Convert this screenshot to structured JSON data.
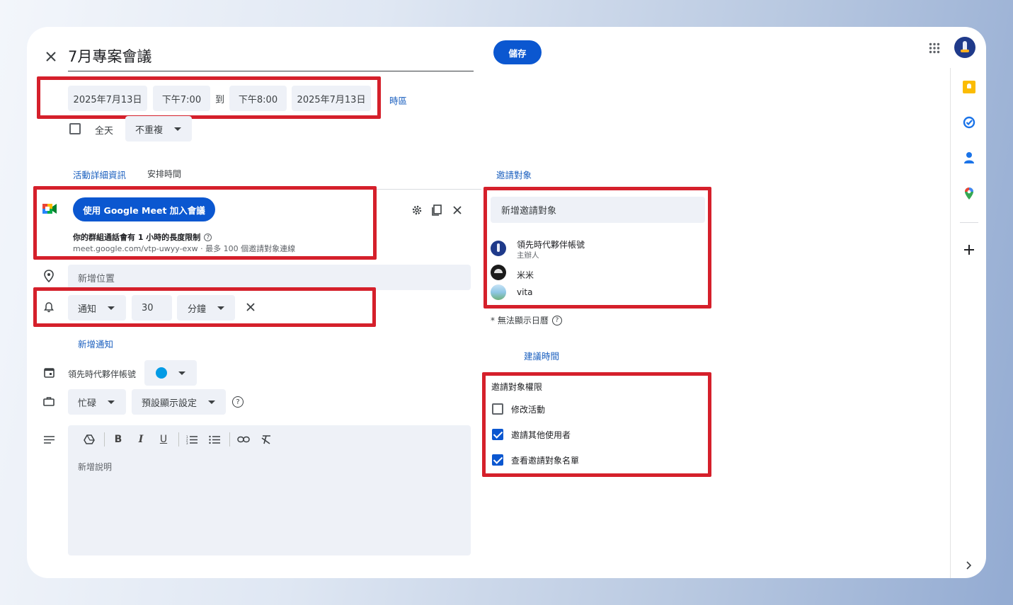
{
  "header": {
    "title": "7月專案會議",
    "save_label": "儲存"
  },
  "datetime": {
    "start_date": "2025年7月13日",
    "start_time": "下午7:00",
    "to_label": "到",
    "end_time": "下午8:00",
    "end_date": "2025年7月13日",
    "timezone_link": "時區",
    "all_day_label": "全天",
    "all_day_checked": false,
    "repeat_value": "不重複"
  },
  "tabs": {
    "details": "活動詳細資訊",
    "schedule": "安排時間",
    "guests": "邀請對象"
  },
  "meet": {
    "join_button": "使用 Google Meet 加入會議",
    "limit_text": "你的群組通話會有 1 小時的長度限制",
    "link_text": "meet.google.com/vtp-uwyy-exw · 最多 100 個邀請對象連線"
  },
  "location": {
    "placeholder": "新增位置"
  },
  "notification": {
    "type": "通知",
    "amount": "30",
    "unit": "分鐘",
    "add_link": "新增通知"
  },
  "calendar": {
    "owner": "領先時代夥伴帳號",
    "color": "#039be5"
  },
  "availability": {
    "busy": "忙碌",
    "visibility": "預設顯示設定"
  },
  "description": {
    "placeholder": "新增說明"
  },
  "guests": {
    "add_placeholder": "新增邀請對象",
    "list": [
      {
        "name": "領先時代夥伴帳號",
        "role": "主辦人"
      },
      {
        "name": "米米",
        "role": ""
      },
      {
        "name": "vita",
        "role": ""
      }
    ],
    "calendar_note": "* 無法顯示日曆",
    "suggest_link": "建議時間"
  },
  "permissions": {
    "title": "邀請對象權限",
    "items": [
      {
        "label": "修改活動",
        "checked": false
      },
      {
        "label": "邀請其他使用者",
        "checked": true
      },
      {
        "label": "查看邀請對象名單",
        "checked": true
      }
    ]
  },
  "colors": {
    "primary": "#0b57d0",
    "highlight": "#d5202b",
    "chip_bg": "#eef1f7"
  }
}
